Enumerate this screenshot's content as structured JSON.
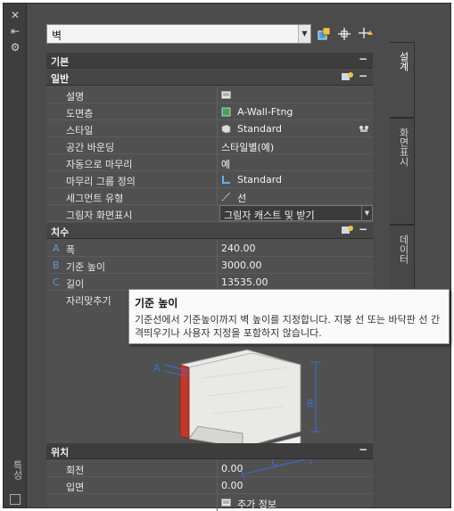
{
  "palette": {
    "strip_title": "특성",
    "strip_buttons": [
      "close-icon",
      "autohide-icon",
      "settings-icon"
    ]
  },
  "header": {
    "selector_value": "벽",
    "icons": [
      "select-objects-icon",
      "pickadd-icon",
      "quick-select-icon"
    ]
  },
  "sections": {
    "basic": "기본",
    "general": "일반",
    "dimensions": "치수",
    "location": "위치"
  },
  "general_rows": [
    {
      "label": "설명",
      "value": "",
      "icon": "description-icon"
    },
    {
      "label": "도면층",
      "value": "A-Wall-Ftng",
      "icon": "layer-swatch-icon",
      "swatch": "#3fa65e"
    },
    {
      "label": "스타일",
      "value": "Standard",
      "icon": "style-icon"
    },
    {
      "label": "공간 바운딩",
      "value": "스타일별(예)"
    },
    {
      "label": "자동으로 마무리",
      "value": "예"
    },
    {
      "label": "마무리 그룹 정의",
      "value": "Standard",
      "icon": "cleanup-group-icon"
    },
    {
      "label": "세그먼트 유형",
      "value": "선",
      "icon": "line-segment-icon"
    },
    {
      "label": "그림자 화면표시",
      "value": "그림자 캐스트 및 받기"
    }
  ],
  "dimension_rows": [
    {
      "key": "A",
      "label": "폭",
      "value": "240.00"
    },
    {
      "key": "B",
      "label": "기준 높이",
      "value": "3000.00"
    },
    {
      "key": "C",
      "label": "길이",
      "value": "13535.00"
    },
    {
      "key": "",
      "label": "자리맞추기",
      "value": ""
    }
  ],
  "diagram_labels": [
    "A",
    "B",
    "C"
  ],
  "location_rows": [
    {
      "label": "회전",
      "value": "0.00"
    },
    {
      "label": "입면",
      "value": "0.00"
    },
    {
      "label": "",
      "value": "추가 정보",
      "icon": "additional-info-icon"
    }
  ],
  "tooltip": {
    "title": "기준 높이",
    "body": "기준선에서 기준높이까지 벽 높이를 지정합니다. 지붕 선 또는 바닥판 선 간격띄우기나 사용자 지정을 포함하지 않습니다."
  },
  "tabs": [
    "설계",
    "화면표시",
    "데이터"
  ],
  "colors": {
    "panel": "#4b4b4b",
    "section": "#3d3d3d",
    "dimension_key": "#5a9ad8",
    "wall_edge": "#c0392b"
  }
}
